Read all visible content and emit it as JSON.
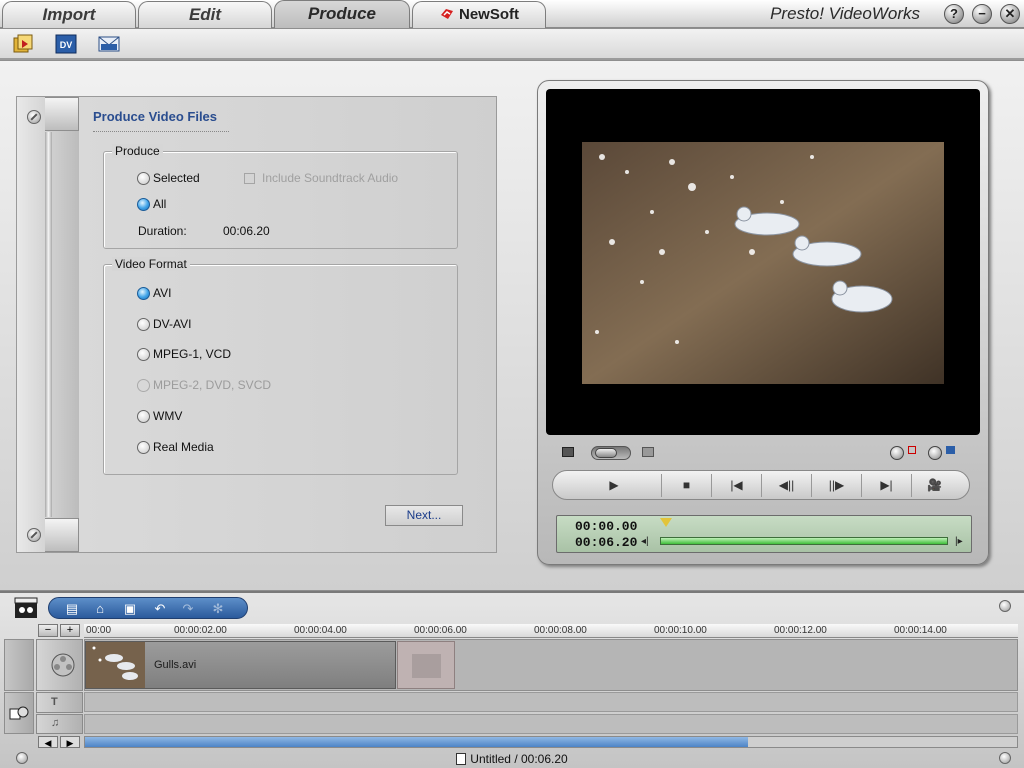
{
  "tabs": [
    {
      "label": "Import",
      "active": false
    },
    {
      "label": "Edit",
      "active": false
    },
    {
      "label": "Produce",
      "active": true
    },
    {
      "label": "NewSoft",
      "active": false
    }
  ],
  "app_title": "Presto! VideoWorks",
  "window_buttons": [
    {
      "icon": "help-icon",
      "glyph": "?"
    },
    {
      "icon": "minimize-icon",
      "glyph": "−"
    },
    {
      "icon": "close-icon",
      "glyph": "✕"
    }
  ],
  "produce_panel": {
    "title": "Produce Video Files",
    "produce_group": {
      "legend": "Produce",
      "options": [
        {
          "label": "Selected",
          "selected": false
        },
        {
          "label": "All",
          "selected": true
        }
      ],
      "include_soundtrack_label": "Include Soundtrack Audio",
      "duration_label": "Duration:",
      "duration_value": "00:06.20"
    },
    "format_group": {
      "legend": "Video Format",
      "options": [
        {
          "label": "AVI",
          "selected": true,
          "disabled": false
        },
        {
          "label": "DV-AVI",
          "selected": false,
          "disabled": false
        },
        {
          "label": "MPEG-1, VCD",
          "selected": false,
          "disabled": false
        },
        {
          "label": "MPEG-2, DVD, SVCD",
          "selected": false,
          "disabled": true
        },
        {
          "label": "WMV",
          "selected": false,
          "disabled": false
        },
        {
          "label": "Real Media",
          "selected": false,
          "disabled": false
        }
      ]
    },
    "next_label": "Next..."
  },
  "preview": {
    "current_time": "00:00.00",
    "total_time": "00:06.20",
    "transport": [
      {
        "icon": "play-icon",
        "glyph": "▶"
      },
      {
        "icon": "stop-icon",
        "glyph": "■"
      },
      {
        "icon": "go-to-start-icon",
        "glyph": "|◀"
      },
      {
        "icon": "previous-frame-icon",
        "glyph": "◀||"
      },
      {
        "icon": "next-frame-icon",
        "glyph": "||▶"
      },
      {
        "icon": "go-to-end-icon",
        "glyph": "▶|"
      },
      {
        "icon": "camera-icon",
        "glyph": "🎥"
      }
    ]
  },
  "timeline": {
    "ruler_ticks": [
      "00:00",
      "00:00:02.00",
      "00:00:04.00",
      "00:00:06.00",
      "00:00:08.00",
      "00:00:10.00",
      "00:00:12.00",
      "00:00:14.00"
    ],
    "clip_name": "Gulls.avi"
  },
  "status": "Untitled / 00:06.20",
  "colors": {
    "accent": "#2a4d8f",
    "selected_radio": "#3fa3e8",
    "timecode_bg": "#b8d0b5"
  }
}
